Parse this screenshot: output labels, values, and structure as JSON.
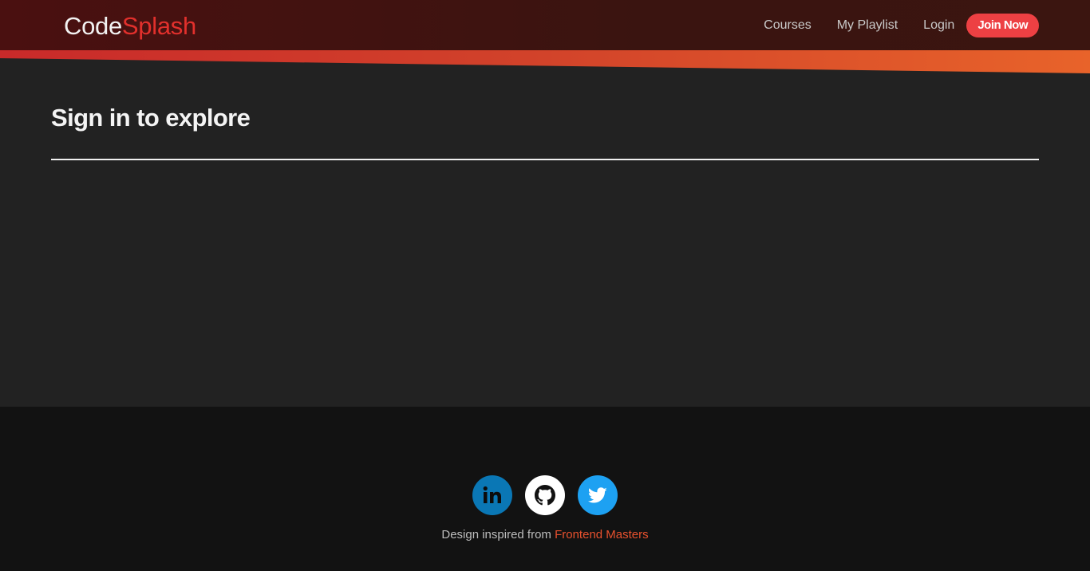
{
  "header": {
    "logo_part1": "Code",
    "logo_part2": "Splash",
    "nav": {
      "courses": "Courses",
      "playlist": "My Playlist",
      "login": "Login",
      "join": "Join Now"
    }
  },
  "main": {
    "title": "Sign in to explore"
  },
  "footer": {
    "socials": [
      {
        "icon": "linkedin-icon",
        "label": "in",
        "color": "#0a77b5"
      },
      {
        "icon": "github-icon",
        "color": "#ffffff"
      },
      {
        "icon": "twitter-icon",
        "color": "#1da1f2"
      }
    ],
    "credit_text": "Design inspired from ",
    "credit_link": "Frontend Masters"
  },
  "colors": {
    "accent": "#ed4043",
    "logo_accent": "#e2302c",
    "link": "#e8512e",
    "header_bg": "#3b1510",
    "page_bg": "#222222",
    "footer_bg": "#121212"
  }
}
